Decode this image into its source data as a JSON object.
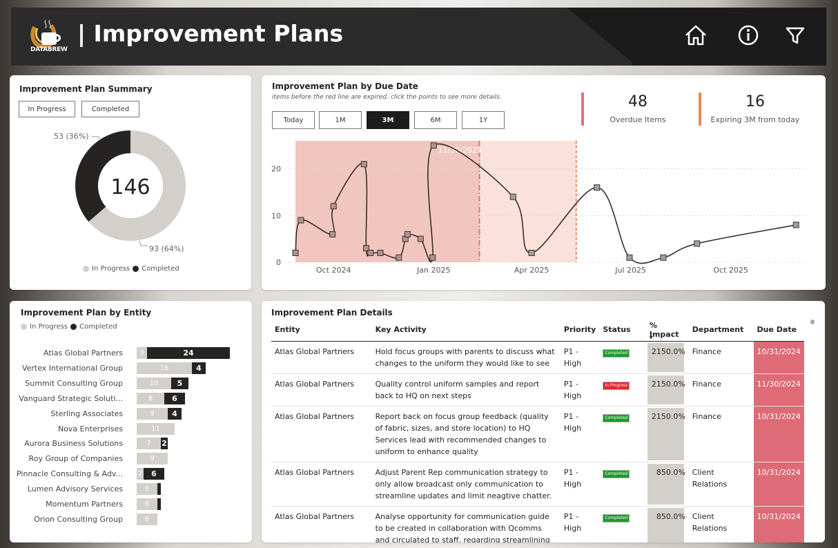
{
  "header": {
    "logo_text": "DATABREW",
    "title": "| Improvement Plans",
    "icons": [
      "home-icon",
      "info-icon",
      "filter-icon"
    ]
  },
  "summary": {
    "title": "Improvement Plan Summary",
    "buttons": [
      "In Progress",
      "Completed"
    ],
    "total": "146",
    "completed_label": "53 (36%)",
    "in_progress_label": "93 (64%)",
    "completed_value": 53,
    "in_progress_value": 93,
    "legend": [
      "In Progress",
      "Completed"
    ],
    "colors": {
      "in_progress": "#d3d0cb",
      "completed": "#252423"
    }
  },
  "due": {
    "title": "Improvement Plan by Due Date",
    "subtitle": "items before the red line are expired. click the points to see more details.",
    "buttons": [
      "Today",
      "1M",
      "3M",
      "6M",
      "1Y"
    ],
    "active_button": "3M",
    "kpis": [
      {
        "value": "48",
        "label": "Overdue Items",
        "color": "#e07079"
      },
      {
        "value": "16",
        "label": "Expiring 3M from today",
        "color": "#e28a57"
      }
    ],
    "marker_label": "11/30/2025"
  },
  "chart_data": {
    "type": "line",
    "x_ticks": [
      "Oct 2024",
      "Jan 2025",
      "Apr 2025",
      "Jul 2025",
      "Oct 2025"
    ],
    "y_ticks": [
      "0",
      "10",
      "20"
    ],
    "ylim": [
      0,
      26
    ],
    "points": [
      {
        "x": "2024-08-27",
        "y": 2
      },
      {
        "x": "2024-09-01",
        "y": 9
      },
      {
        "x": "2024-09-30",
        "y": 6
      },
      {
        "x": "2024-10-01",
        "y": 12
      },
      {
        "x": "2024-10-29",
        "y": 21
      },
      {
        "x": "2024-10-31",
        "y": 3
      },
      {
        "x": "2024-11-04",
        "y": 2
      },
      {
        "x": "2024-11-13",
        "y": 2
      },
      {
        "x": "2024-11-30",
        "y": 1
      },
      {
        "x": "2024-12-06",
        "y": 5
      },
      {
        "x": "2024-12-08",
        "y": 6
      },
      {
        "x": "2024-12-20",
        "y": 5
      },
      {
        "x": "2024-12-31",
        "y": 1
      },
      {
        "x": "2025-01-01",
        "y": 25
      },
      {
        "x": "2025-03-15",
        "y": 14
      },
      {
        "x": "2025-04-01",
        "y": 2
      },
      {
        "x": "2025-05-31",
        "y": 16
      },
      {
        "x": "2025-06-30",
        "y": 1
      },
      {
        "x": "2025-07-31",
        "y": 1
      },
      {
        "x": "2025-08-31",
        "y": 4
      },
      {
        "x": "2025-11-30",
        "y": 8
      }
    ],
    "expired_before": "2025-02-12",
    "window_end": "2025-05-12"
  },
  "entity": {
    "title": "Improvement Plan by Entity",
    "legend": [
      "In Progress",
      "Completed"
    ],
    "rows": [
      {
        "name": "Atlas Global Partners",
        "in_progress": 3,
        "completed": 24
      },
      {
        "name": "Vertex International Group",
        "in_progress": 16,
        "completed": 4
      },
      {
        "name": "Summit Consulting Group",
        "in_progress": 10,
        "completed": 5
      },
      {
        "name": "Vanguard Strategic Soluti...",
        "in_progress": 8,
        "completed": 6
      },
      {
        "name": "Sterling Associates",
        "in_progress": 9,
        "completed": 4
      },
      {
        "name": "Nova Enterprises",
        "in_progress": 11,
        "completed": 0
      },
      {
        "name": "Aurora Business Solutions",
        "in_progress": 7,
        "completed": 2
      },
      {
        "name": "Roy Group of Companies",
        "in_progress": 9,
        "completed": 0
      },
      {
        "name": "Pinnacle Consulting & Adv...",
        "in_progress": 2,
        "completed": 6
      },
      {
        "name": "Lumen Advisory Services",
        "in_progress": 6,
        "completed": 1
      },
      {
        "name": "Momentum Partners",
        "in_progress": 6,
        "completed": 1
      },
      {
        "name": "Orion Consulting Group",
        "in_progress": 6,
        "completed": 0
      }
    ]
  },
  "details": {
    "title": "Improvement Plan Details",
    "columns": [
      "Entity",
      "Key Activity",
      "Priority",
      "Status",
      "% Impact",
      "Department",
      "Due Date"
    ],
    "rows": [
      {
        "entity": "Atlas Global Partners",
        "activity": "Hold focus groups with parents to discuss what changes to the uniform they would like to see",
        "priority": "P1 - High",
        "status": "Completed",
        "impact": "2150.0%",
        "department": "Finance",
        "due": "10/31/2024"
      },
      {
        "entity": "Atlas Global Partners",
        "activity": "Quality control uniform samples and report back to HQ on next steps",
        "priority": "P1 - High",
        "status": "In Progress",
        "impact": "2150.0%",
        "department": "Finance",
        "due": "11/30/2024"
      },
      {
        "entity": "Atlas Global Partners",
        "activity": "Report back on focus group feedback (quality of fabric, sizes, and store location) to HQ Services lead with recommended changes to uniform to enhance quality",
        "priority": "P1 - High",
        "status": "Completed",
        "impact": "2150.0%",
        "department": "Finance",
        "due": "10/31/2024"
      },
      {
        "entity": "Atlas Global Partners",
        "activity": "Adjust Parent Rep communication strategy to only allow broadcast only communication to streamline updates and limit neagtive chatter.",
        "priority": "P1 - High",
        "status": "Completed",
        "impact": "850.0%",
        "department": "Client Relations",
        "due": "10/31/2024"
      },
      {
        "entity": "Atlas Global Partners",
        "activity": "Analyse opportunity for communication guide to be created in collaboration with Qcomms and circulated to staff, regarding streamlining parent",
        "priority": "P1 - High",
        "status": "Completed",
        "impact": "850.0%",
        "department": "Client Relations",
        "due": "10/31/2024"
      }
    ],
    "status_colors": {
      "Completed": "#1e9a2b",
      "In Progress": "#e8262f"
    }
  }
}
